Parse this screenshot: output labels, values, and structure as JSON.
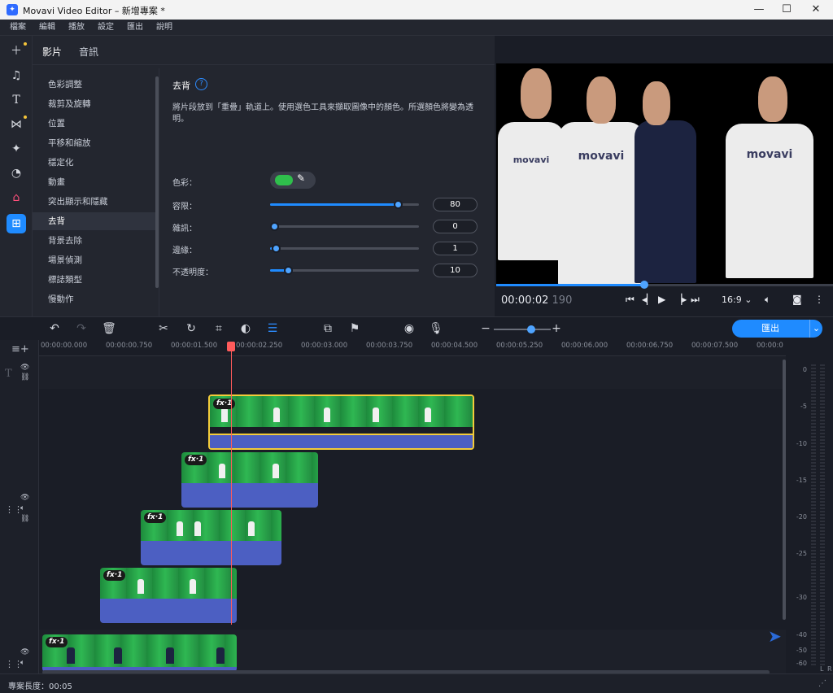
{
  "window": {
    "title": "Movavi Video Editor – 新增專案 *",
    "minimize": "—",
    "maximize": "☐",
    "close": "✕"
  },
  "menu": [
    "檔案",
    "編輯",
    "播放",
    "設定",
    "匯出",
    "說明"
  ],
  "tool_icons": [
    "add-icon",
    "music-icon",
    "text-icon",
    "transition-icon",
    "magic-icon",
    "sticker-icon",
    "filter-icon",
    "more-tools-icon"
  ],
  "tabs": {
    "video": "影片",
    "audio": "音訊"
  },
  "effects": [
    "色彩調整",
    "裁剪及旋轉",
    "位置",
    "平移和縮放",
    "穩定化",
    "動畫",
    "突出顯示和隱藏",
    "去背",
    "背景去除",
    "場景偵測",
    "標誌類型",
    "慢動作"
  ],
  "selected_effect": "去背",
  "props": {
    "title": "去背",
    "help": "?",
    "description": "將片段放到「重疊」軌道上。使用選色工具來擷取圖像中的顏色。所選顏色將變為透明。",
    "color_label": "色彩：",
    "color_value": "#2fbf4c",
    "sliders": [
      {
        "label": "容限：",
        "value": "80",
        "fraction": 0.86
      },
      {
        "label": "雜訊：",
        "value": "0",
        "fraction": 0.03
      },
      {
        "label": "邊緣：",
        "value": "1",
        "fraction": 0.04
      },
      {
        "label": "不透明度：",
        "value": "10",
        "fraction": 0.12
      }
    ]
  },
  "preview": {
    "logo": "movavi",
    "progress": 0.44,
    "timecode": "00:00:02",
    "timecode_ms": "190",
    "aspect": "16:9 ⌄"
  },
  "timeline": {
    "export_label": "匯出",
    "export_arrow": "⌄",
    "ticks": [
      "00:00:00.000",
      "00:00:00.750",
      "00:00:01.500",
      "00:00:02.250",
      "00:00:03.000",
      "00:00:03.750",
      "00:00:04.500",
      "00:00:05.250",
      "00:00:06.000",
      "00:00:06.750",
      "00:00:07.500",
      "00:00:0"
    ],
    "fx_label": "fx·1"
  },
  "meter": {
    "labels": [
      "0",
      "-5",
      "-10",
      "-15",
      "-20",
      "-25",
      "-30",
      "-40",
      "-50",
      "-60"
    ],
    "left": "L",
    "right": "R"
  },
  "status": {
    "project_length": "專案長度：00:05"
  }
}
